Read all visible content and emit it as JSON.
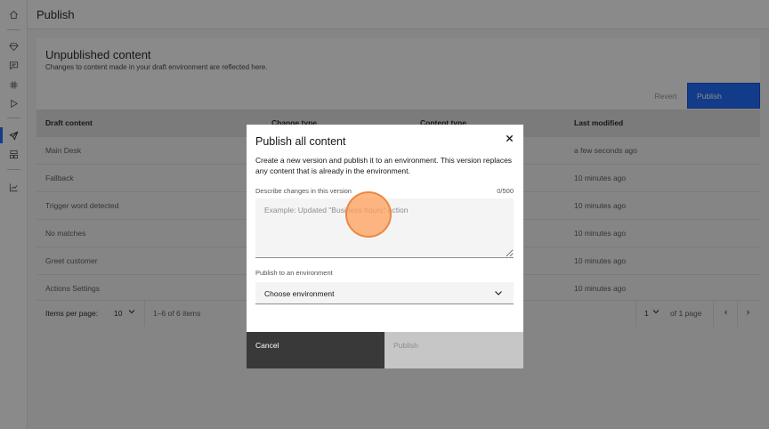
{
  "header": {
    "title": "Publish"
  },
  "rail": {
    "items": [
      {
        "icon": "home-icon"
      },
      {
        "icon": "diamond-icon"
      },
      {
        "icon": "chat-icon"
      },
      {
        "icon": "hashtag-icon"
      },
      {
        "icon": "play-icon"
      },
      {
        "icon": "publish-rocket-icon",
        "active": true
      },
      {
        "icon": "environments-icon"
      },
      {
        "icon": "analytics-icon"
      }
    ]
  },
  "card": {
    "title": "Unpublished content",
    "subtitle": "Changes to content made in your draft environment are reflected here.",
    "revert_label": "Revert",
    "publish_label": "Publish",
    "columns": [
      "Draft content",
      "Change type",
      "Content type",
      "Last modified"
    ],
    "rows": [
      {
        "name": "Main Desk",
        "modified": "a few seconds ago"
      },
      {
        "name": "Fallback",
        "modified": "10 minutes ago"
      },
      {
        "name": "Trigger word detected",
        "modified": "10 minutes ago"
      },
      {
        "name": "No matches",
        "modified": "10 minutes ago"
      },
      {
        "name": "Greet customer",
        "modified": "10 minutes ago"
      },
      {
        "name": "Actions Settings",
        "modified": "10 minutes ago"
      }
    ],
    "pager": {
      "items_per_page_label": "Items per page:",
      "items_per_page": "10",
      "range": "1–6 of 6 items",
      "page": "1",
      "page_of": "of 1 page"
    }
  },
  "modal": {
    "title": "Publish all content",
    "description": "Create a new version and publish it to an environment. This version replaces any content that is already in the environment.",
    "changes_label": "Describe changes in this version",
    "changes_count": "0/500",
    "changes_placeholder": "Example: Updated \"Business hours\" action",
    "env_label": "Publish to an environment",
    "env_value": "Choose environment",
    "cancel_label": "Cancel",
    "publish_label": "Publish"
  },
  "colors": {
    "primary": "#0f62fe",
    "overlay": "#161616",
    "cursor": "#ffa05a"
  }
}
